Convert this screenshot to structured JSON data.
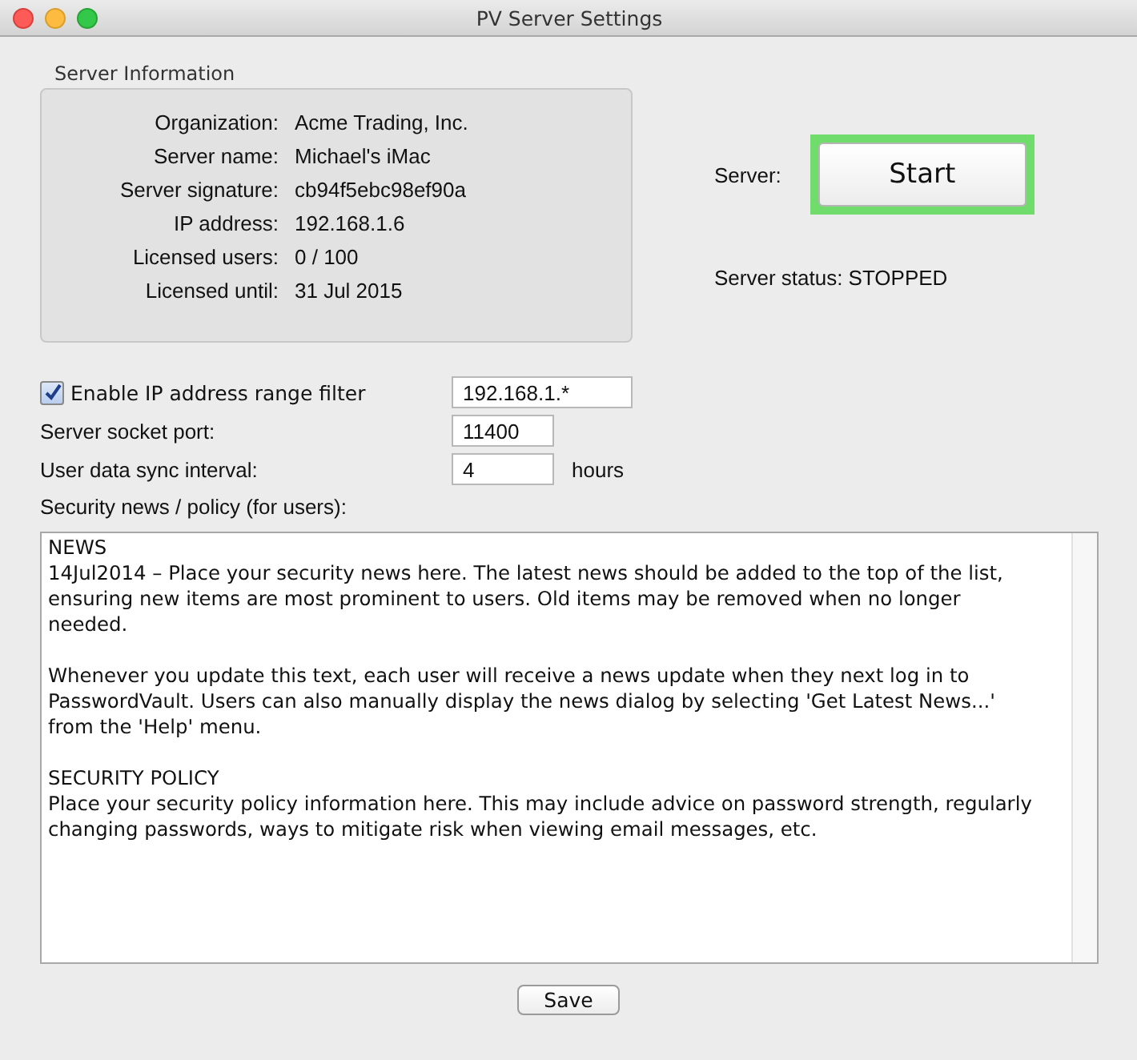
{
  "window": {
    "title": "PV Server Settings"
  },
  "server_information": {
    "title": "Server Information",
    "fields": [
      {
        "label": "Organization:",
        "value": "Acme Trading, Inc."
      },
      {
        "label": "Server name:",
        "value": "Michael's iMac"
      },
      {
        "label": "Server signature:",
        "value": "cb94f5ebc98ef90a"
      },
      {
        "label": "IP address:",
        "value": "192.168.1.6"
      },
      {
        "label": "Licensed users:",
        "value": "0 / 100"
      },
      {
        "label": "Licensed until:",
        "value": "31 Jul 2015"
      }
    ]
  },
  "server_control": {
    "label": "Server:",
    "button": "Start",
    "highlighted": true,
    "status": "Server status: STOPPED"
  },
  "settings": [
    {
      "kind": "checkbox",
      "label": "Enable IP address range filter",
      "checked": true,
      "value": "192.168.1.*"
    },
    {
      "kind": "text",
      "label": "Server socket port:",
      "value": "11400"
    },
    {
      "kind": "text",
      "label": "User data sync interval:",
      "value": "4",
      "unit": "hours"
    }
  ],
  "security_news": {
    "label": "Security news / policy (for users):",
    "paragraphs": [
      [
        "NEWS",
        "14Jul2014 – Place your security news here. The latest news should be added to the top of the list, ensuring new items are most prominent to users. Old items may be removed when no longer needed."
      ],
      [
        "Whenever you update this text, each user will receive a news update when they next log in to PasswordVault. Users can also manually display the news dialog by selecting 'Get Latest News...' from the 'Help' menu."
      ],
      [
        "SECURITY POLICY",
        "Place your security policy information here. This may include advice on password strength, regularly changing passwords, ways to mitigate risk when viewing email messages, etc."
      ]
    ]
  },
  "buttons": [
    "Save"
  ]
}
